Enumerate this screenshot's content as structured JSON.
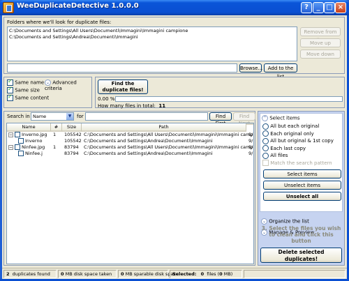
{
  "window": {
    "title": "WeeDuplicateDetective 1.0.0.0",
    "help": "?",
    "minimize": "_",
    "maximize": "□",
    "close": "×"
  },
  "folders": {
    "label": "Folders where we'll look for duplicate files:",
    "items": [
      "C:\\Documents and Settings\\All Users\\Documenti\\Immagini\\Immagini campione",
      "C:\\Documents and Settings\\Andrea\\Documenti\\Immagini"
    ],
    "remove": "Remove from list",
    "move_up": "Move up",
    "move_down": "Move down",
    "browse": "Browse...",
    "add": "Add to the list",
    "path_value": ""
  },
  "criteria": {
    "same_name": "Same name",
    "same_size": "Same size",
    "same_content": "Same content",
    "advanced": "Advanced criteria",
    "find": "Find the duplicate files!",
    "progress_text": "0.00 %",
    "progress": 0,
    "total_label": "How many files in total:",
    "total_value": "11"
  },
  "search": {
    "label": "Search in",
    "field": "Name",
    "for": "for",
    "query": "",
    "find_first": "Find First",
    "find_next": "Find Next"
  },
  "table": {
    "columns": [
      "Name",
      "#",
      "Size",
      "Path",
      ""
    ],
    "rows": [
      {
        "expander": "−",
        "name": "Inverno.jpg",
        "num": "1",
        "size": "105542",
        "path": "C:\\Documents and Settings\\All Users\\Documenti\\Immagini\\Immagini campione",
        "extra": "9/"
      },
      {
        "expander": "",
        "name": "Inverno",
        "num": "",
        "size": "105542",
        "path": "C:\\Documents and Settings\\Andrea\\Documenti\\Immagini",
        "extra": "9/"
      },
      {
        "expander": "−",
        "name": "Ninfee.jpg",
        "num": "1",
        "size": "83794",
        "path": "C:\\Documents and Settings\\All Users\\Documenti\\Immagini\\Immagini campione",
        "extra": "9/"
      },
      {
        "expander": "",
        "name": "Ninfee.j",
        "num": "",
        "size": "83794",
        "path": "C:\\Documents and Settings\\Andrea\\Documenti\\Immagini",
        "extra": "9/"
      }
    ]
  },
  "select": {
    "title": "Select items",
    "options": [
      "All but each original",
      "Each original only",
      "All but original & 1st copy",
      "Each last copy",
      "All files"
    ],
    "match_pattern": "Match the search pattern",
    "select_items": "Select items",
    "unselect_items": "Unselect items",
    "unselect_all": "Unselect all",
    "organize": "Organize the list",
    "manage": "Manage & Preview",
    "hint": "3. Select the files you wish to clean and click this button",
    "delete": "Delete selected duplicates!"
  },
  "status": {
    "dup_count": "2",
    "dup_label": "duplicates found",
    "disk_taken_value": "0",
    "disk_taken_label": "MB disk space taken",
    "sparable_value": "0",
    "sparable_label": "MB sparable disk space",
    "selected_label": "Selected:",
    "selected_files": "0",
    "files_label": "files (",
    "selected_mb": "0",
    "mb_label": "MB)"
  },
  "colors": {
    "titlebar": "#0a55d8",
    "client": "#ece9d8",
    "accent": "#316ac5"
  }
}
